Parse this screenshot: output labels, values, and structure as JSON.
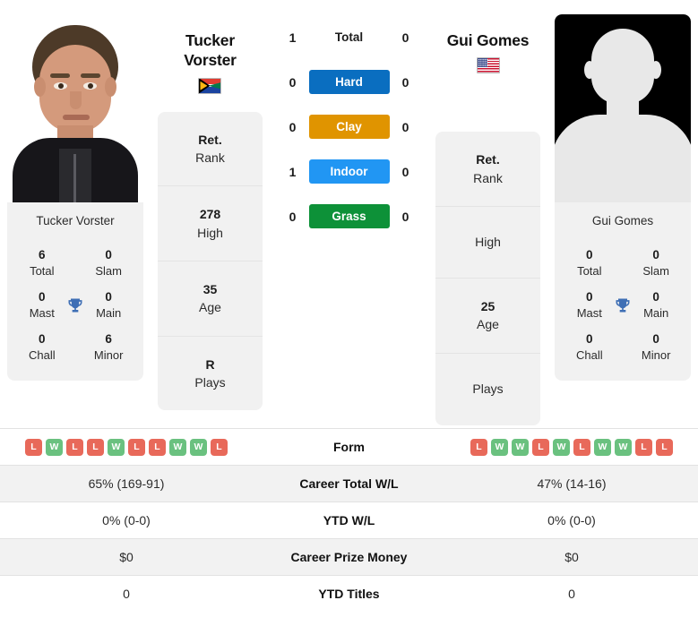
{
  "players": {
    "left": {
      "name": "Tucker Vorster",
      "title_line1": "Tucker",
      "title_line2": "Vorster",
      "flag": "south-africa-flag",
      "photo_type": "photo",
      "titles": [
        {
          "value": "6",
          "label": "Total"
        },
        {
          "value": "0",
          "label": "Slam"
        },
        {
          "value": "0",
          "label": "Mast"
        },
        {
          "value": "0",
          "label": "Main"
        },
        {
          "value": "0",
          "label": "Chall"
        },
        {
          "value": "6",
          "label": "Minor"
        }
      ],
      "info": [
        {
          "value": "Ret.",
          "label": "Rank"
        },
        {
          "value": "278",
          "label": "High"
        },
        {
          "value": "35",
          "label": "Age"
        },
        {
          "value": "R",
          "label": "Plays"
        }
      ],
      "form": [
        "L",
        "W",
        "L",
        "L",
        "W",
        "L",
        "L",
        "W",
        "W",
        "L"
      ],
      "career_total_wl": "65% (169-91)",
      "ytd_wl": "0% (0-0)",
      "career_prize_money": "$0",
      "ytd_titles": "0"
    },
    "right": {
      "name": "Gui Gomes",
      "title_line1": "Gui Gomes",
      "title_line2": "",
      "flag": "usa-flag",
      "photo_type": "silhouette",
      "titles": [
        {
          "value": "0",
          "label": "Total"
        },
        {
          "value": "0",
          "label": "Slam"
        },
        {
          "value": "0",
          "label": "Mast"
        },
        {
          "value": "0",
          "label": "Main"
        },
        {
          "value": "0",
          "label": "Chall"
        },
        {
          "value": "0",
          "label": "Minor"
        }
      ],
      "info": [
        {
          "value": "Ret.",
          "label": "Rank"
        },
        {
          "value": "",
          "label": "High"
        },
        {
          "value": "25",
          "label": "Age"
        },
        {
          "value": "",
          "label": "Plays"
        }
      ],
      "form": [
        "L",
        "W",
        "W",
        "L",
        "W",
        "L",
        "W",
        "W",
        "L",
        "L"
      ],
      "career_total_wl": "47% (14-16)",
      "ytd_wl": "0% (0-0)",
      "career_prize_money": "$0",
      "ytd_titles": "0"
    }
  },
  "head_to_head": [
    {
      "label": "Total",
      "left": "1",
      "right": "0",
      "color": ""
    },
    {
      "label": "Hard",
      "left": "0",
      "right": "0",
      "color": "#0a6ec0"
    },
    {
      "label": "Clay",
      "left": "0",
      "right": "0",
      "color": "#e09400"
    },
    {
      "label": "Indoor",
      "left": "1",
      "right": "0",
      "color": "#2196f3"
    },
    {
      "label": "Grass",
      "left": "0",
      "right": "0",
      "color": "#0d9138"
    }
  ],
  "table_rows": [
    {
      "label": "Form"
    },
    {
      "label": "Career Total W/L"
    },
    {
      "label": "YTD W/L"
    },
    {
      "label": "Career Prize Money"
    },
    {
      "label": "YTD Titles"
    }
  ],
  "colors": {
    "win_badge": "#6ac17f",
    "loss_badge": "#e8695a",
    "trophy": "#3f6fb5",
    "panel_bg": "#f1f1f1",
    "row_alt_bg": "#f2f2f2"
  }
}
